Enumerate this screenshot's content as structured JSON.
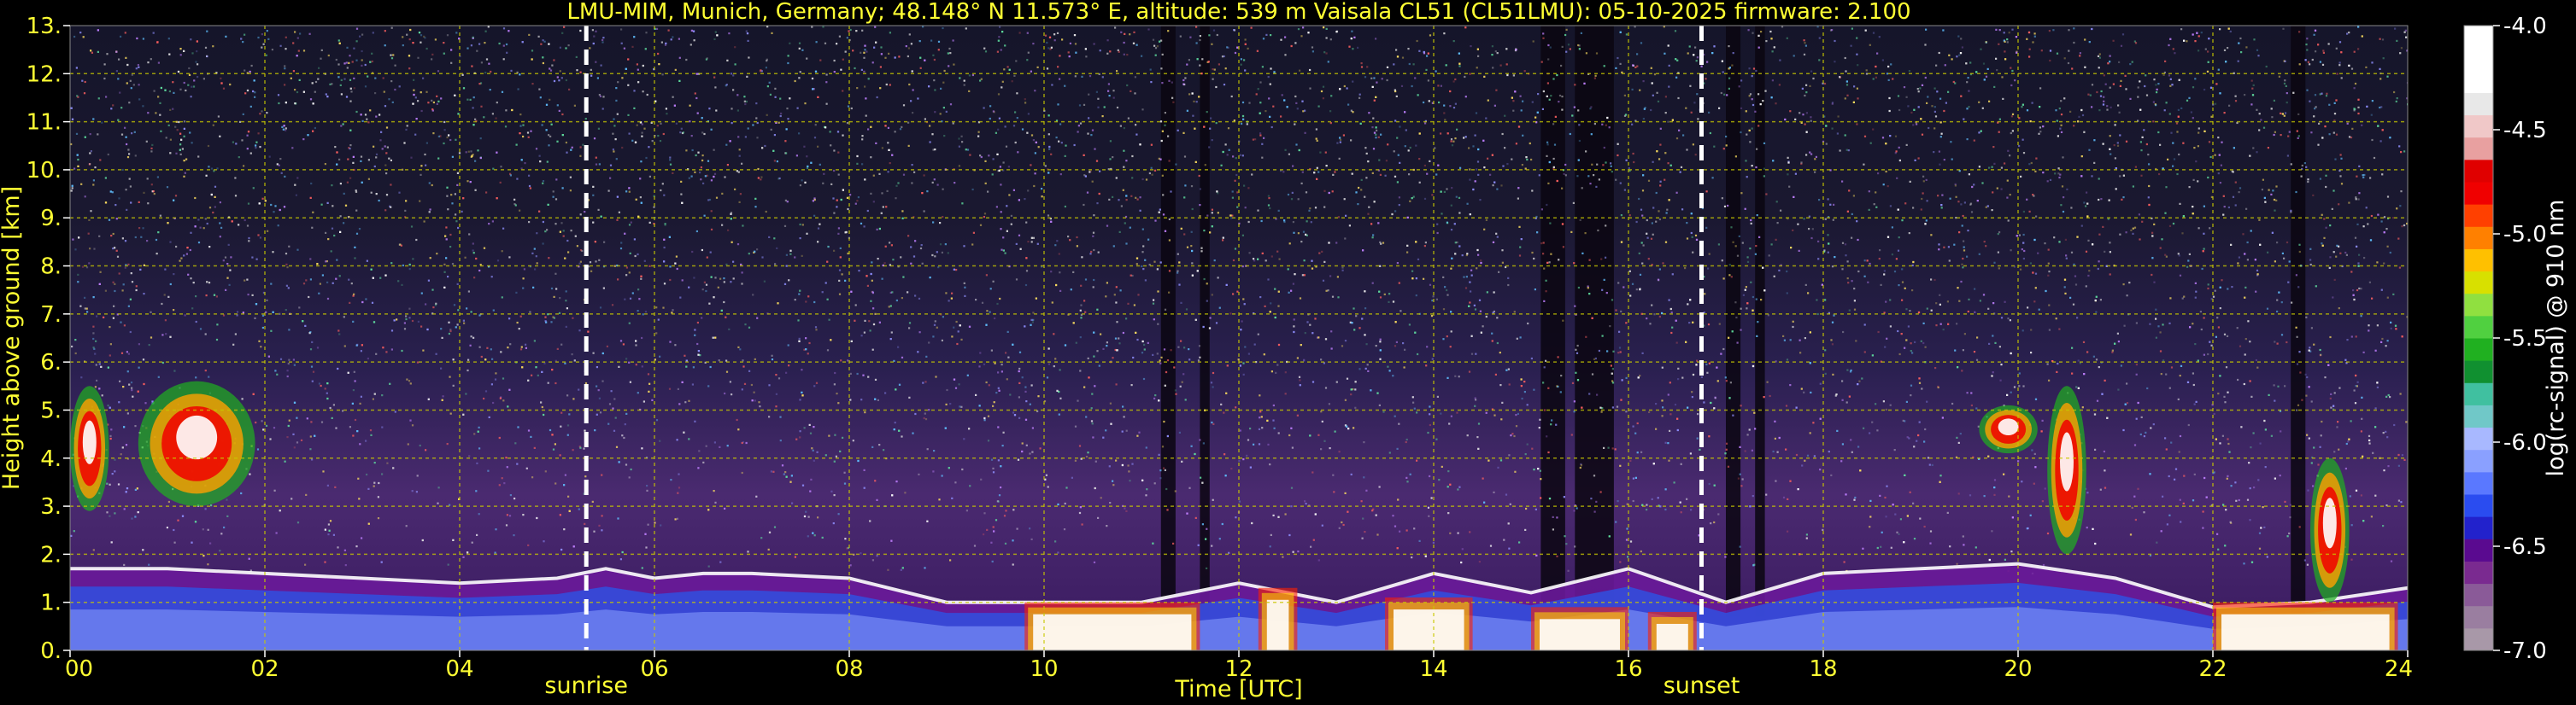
{
  "chart_data": {
    "type": "heatmap",
    "title": "LMU-MIM, Munich, Germany; 48.148° N 11.573° E, altitude: 539 m    Vaisala CL51 (CL51LMU): 05-10-2025    firmware: 2.100",
    "xlabel": "Time [UTC]",
    "ylabel": "Height above ground [km]",
    "colorbar_label": "log(rc-signal) @ 910 nm",
    "xlim": [
      0,
      24
    ],
    "ylim": [
      0,
      13
    ],
    "x_ticks": [
      0,
      2,
      4,
      6,
      8,
      10,
      12,
      14,
      16,
      18,
      20,
      22,
      24
    ],
    "x_tick_labels": [
      "00",
      "02",
      "04",
      "06",
      "08",
      "10",
      "12",
      "14",
      "16",
      "18",
      "20",
      "22",
      "24"
    ],
    "y_ticks": [
      0,
      1,
      2,
      3,
      4,
      5,
      6,
      7,
      8,
      9,
      10,
      11,
      12,
      13
    ],
    "y_tick_labels": [
      "0.",
      "1.",
      "2.",
      "3.",
      "4.",
      "5.",
      "6.",
      "7.",
      "8.",
      "9.",
      "10.",
      "11.",
      "12.",
      "13."
    ],
    "color_range": [
      -7.0,
      -4.0
    ],
    "colorbar_ticks": [
      -7.0,
      -6.5,
      -6.0,
      -5.5,
      -5.0,
      -4.5,
      -4.0
    ],
    "colorbar_tick_labels": [
      "-7.0",
      "-6.5",
      "-6.0",
      "-5.5",
      "-5.0",
      "-4.5",
      "-4.0"
    ],
    "colorbar_colors": [
      "#a898a8",
      "#9a7ea0",
      "#8a5a98",
      "#7a2a90",
      "#5a0a90",
      "#2222cc",
      "#2a4cf0",
      "#5a78ff",
      "#8aa0ff",
      "#a8b8ff",
      "#70c8c8",
      "#40c0a0",
      "#109030",
      "#20b020",
      "#50d040",
      "#90e040",
      "#d8e000",
      "#ffc000",
      "#ff8000",
      "#ff4000",
      "#f00000",
      "#e00000",
      "#e8a0a0",
      "#f0c8c8",
      "#e8e8e8",
      "#ffffff",
      "#ffffff",
      "#ffffff"
    ],
    "grid": true,
    "grid_color": "#c8c800",
    "text_color": "#ffff33",
    "markers": [
      {
        "label": "sunrise",
        "x": 5.3
      },
      {
        "label": "sunset",
        "x": 16.75
      }
    ],
    "features": {
      "boundary_layer_top_km": [
        [
          0.0,
          1.7
        ],
        [
          1.0,
          1.7
        ],
        [
          2.0,
          1.6
        ],
        [
          3.0,
          1.5
        ],
        [
          4.0,
          1.4
        ],
        [
          5.0,
          1.5
        ],
        [
          5.5,
          1.7
        ],
        [
          6.0,
          1.5
        ],
        [
          6.5,
          1.6
        ],
        [
          7.0,
          1.6
        ],
        [
          8.0,
          1.5
        ],
        [
          9.0,
          1.0
        ],
        [
          10.0,
          1.0
        ],
        [
          11.0,
          1.0
        ],
        [
          12.0,
          1.4
        ],
        [
          13.0,
          1.0
        ],
        [
          14.0,
          1.6
        ],
        [
          15.0,
          1.2
        ],
        [
          16.0,
          1.7
        ],
        [
          17.0,
          1.0
        ],
        [
          18.0,
          1.6
        ],
        [
          19.0,
          1.7
        ],
        [
          20.0,
          1.8
        ],
        [
          21.0,
          1.5
        ],
        [
          22.0,
          0.9
        ],
        [
          23.0,
          1.0
        ],
        [
          24.0,
          1.3
        ]
      ],
      "clouds": [
        {
          "t0": 0.0,
          "t1": 0.4,
          "h0": 2.9,
          "h1": 5.5
        },
        {
          "t0": 0.7,
          "t1": 1.9,
          "h0": 3.0,
          "h1": 5.6
        },
        {
          "t0": 19.6,
          "t1": 20.2,
          "h0": 4.1,
          "h1": 5.1
        },
        {
          "t0": 20.3,
          "t1": 20.7,
          "h0": 2.0,
          "h1": 5.5
        },
        {
          "t0": 23.0,
          "t1": 23.4,
          "h0": 1.0,
          "h1": 4.0
        }
      ],
      "low_clouds": [
        {
          "t0": 9.8,
          "t1": 11.6,
          "h0": 0.0,
          "h1": 1.0
        },
        {
          "t0": 12.2,
          "t1": 12.6,
          "h0": 0.0,
          "h1": 1.3
        },
        {
          "t0": 13.5,
          "t1": 14.4,
          "h0": 0.0,
          "h1": 1.1
        },
        {
          "t0": 15.0,
          "t1": 16.0,
          "h0": 0.0,
          "h1": 0.9
        },
        {
          "t0": 16.2,
          "t1": 16.7,
          "h0": 0.0,
          "h1": 0.8
        },
        {
          "t0": 22.0,
          "t1": 23.9,
          "h0": 0.0,
          "h1": 1.0
        }
      ]
    }
  }
}
